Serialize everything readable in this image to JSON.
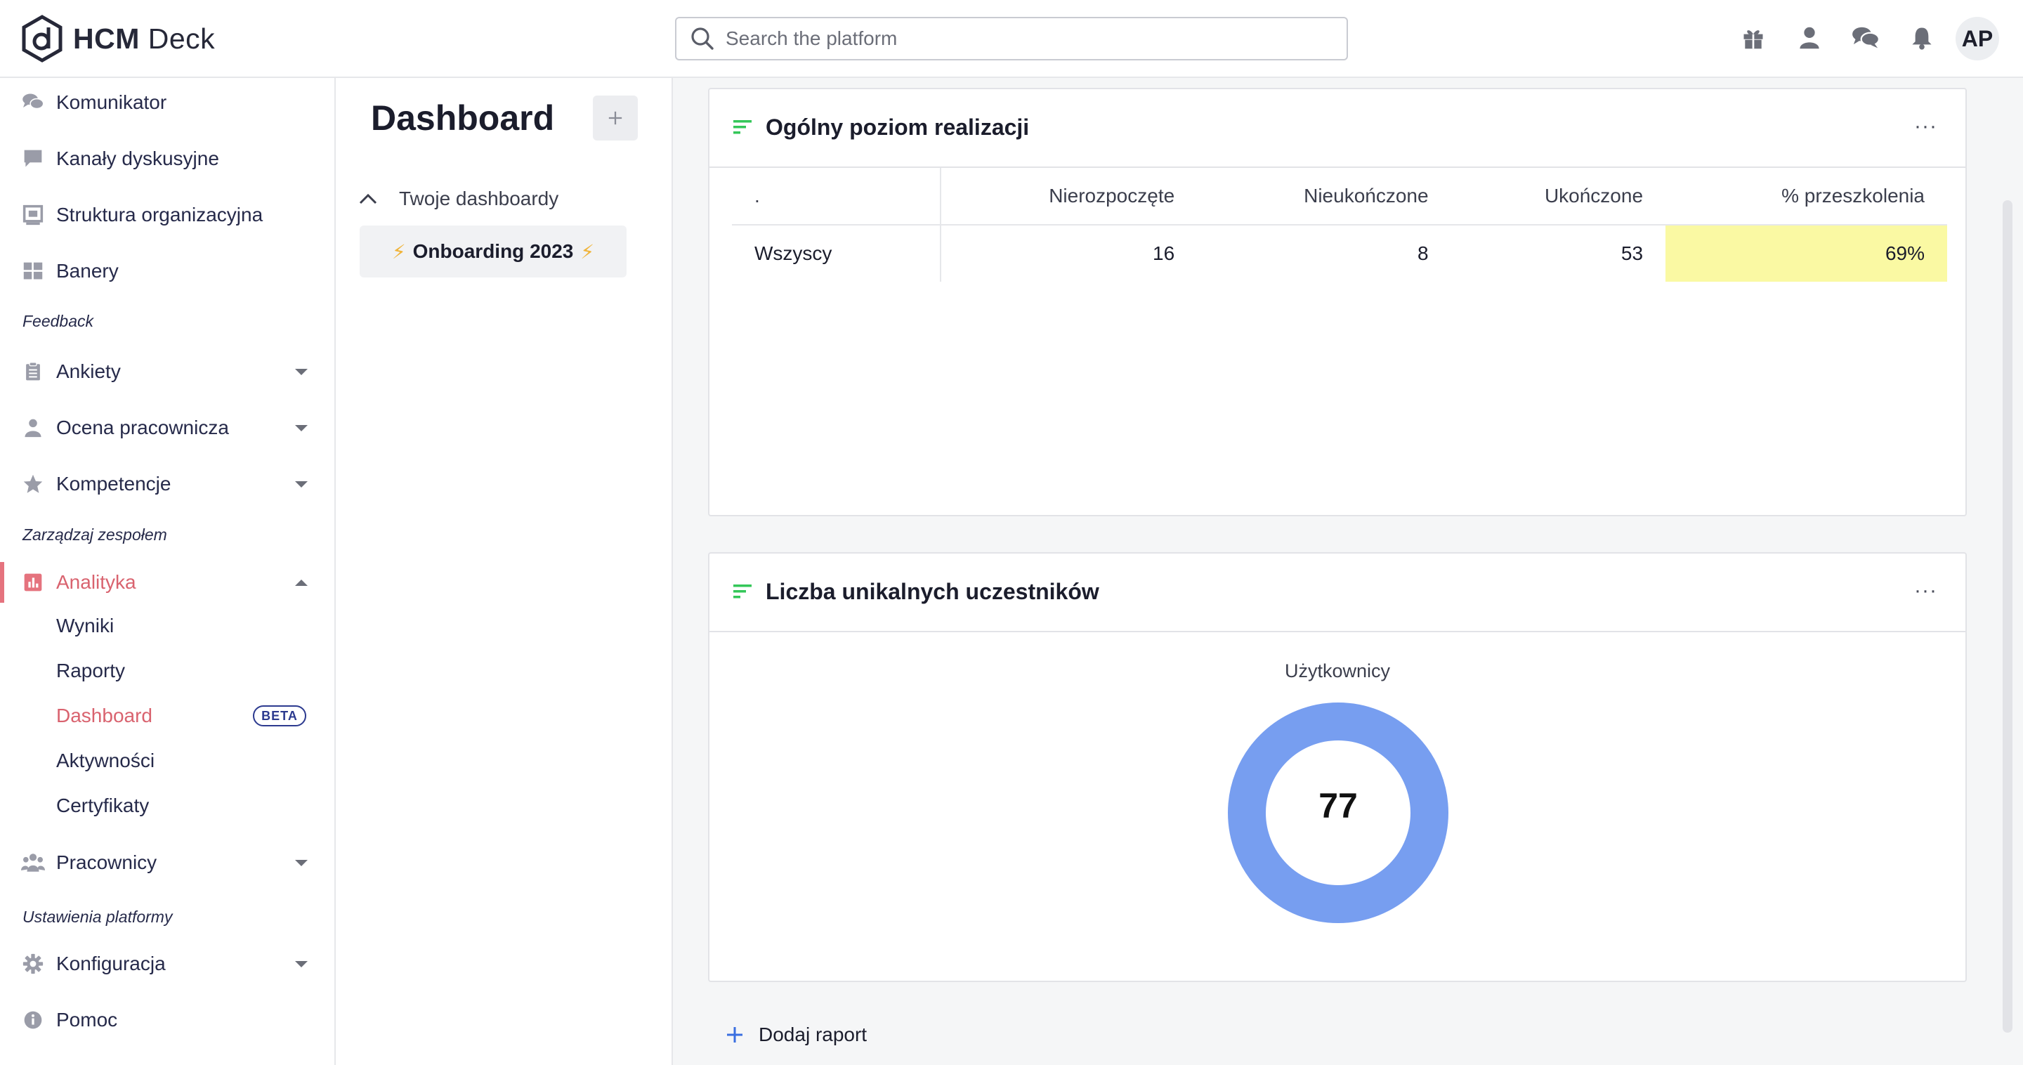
{
  "brand": {
    "name_bold": "HCM",
    "name_light": " Deck"
  },
  "search": {
    "placeholder": "Search the platform"
  },
  "user": {
    "initials": "AP"
  },
  "topbar_icons": [
    "gift-icon",
    "user-icon",
    "chat-icon",
    "bell-icon"
  ],
  "sidebar": {
    "items_top": [
      {
        "label": "Komunikator",
        "icon": "chat-icon"
      },
      {
        "label": "Kanały dyskusyjne",
        "icon": "message-icon"
      },
      {
        "label": "Struktura organizacyjna",
        "icon": "org-icon"
      },
      {
        "label": "Banery",
        "icon": "grid-icon"
      }
    ],
    "section_feedback": "Feedback",
    "items_feedback": [
      {
        "label": "Ankiety",
        "icon": "clipboard-icon"
      },
      {
        "label": "Ocena pracownicza",
        "icon": "person-icon"
      },
      {
        "label": "Kompetencje",
        "icon": "star-icon"
      }
    ],
    "section_team": "Zarządzaj zespołem",
    "analytics": {
      "label": "Analityka",
      "icon": "chart-icon"
    },
    "analytics_sub": [
      "Wyniki",
      "Raporty",
      "Dashboard",
      "Aktywności",
      "Certyfikaty"
    ],
    "beta_badge": "BETA",
    "employees": {
      "label": "Pracownicy",
      "icon": "people-icon"
    },
    "section_settings": "Ustawienia platformy",
    "config": {
      "label": "Konfiguracja",
      "icon": "gear-icon"
    },
    "help": {
      "label": "Pomoc",
      "icon": "info-icon"
    }
  },
  "dashboards_panel": {
    "title": "Dashboard",
    "group_label": "Twoje dashboardy",
    "items": [
      {
        "label": "Onboarding 2023",
        "prefix": "⚡",
        "suffix": "⚡"
      }
    ]
  },
  "report1": {
    "title": "Ogólny poziom realizacji",
    "columns": [
      ".",
      "Nierozpoczęte",
      "Nieukończone",
      "Ukończone",
      "% przeszkolenia"
    ],
    "rows": [
      [
        "Wszyscy",
        "16",
        "8",
        "53",
        "69%"
      ]
    ]
  },
  "report2": {
    "title": "Liczba unikalnych uczestników",
    "chart_label": "Użytkownicy",
    "value": "77",
    "ring_color": "#779ef0"
  },
  "add_report_label": "Dodaj raport",
  "colors": {
    "accent": "#d9636f",
    "highlight": "#faf9a3",
    "filter_icon": "#34c759"
  }
}
